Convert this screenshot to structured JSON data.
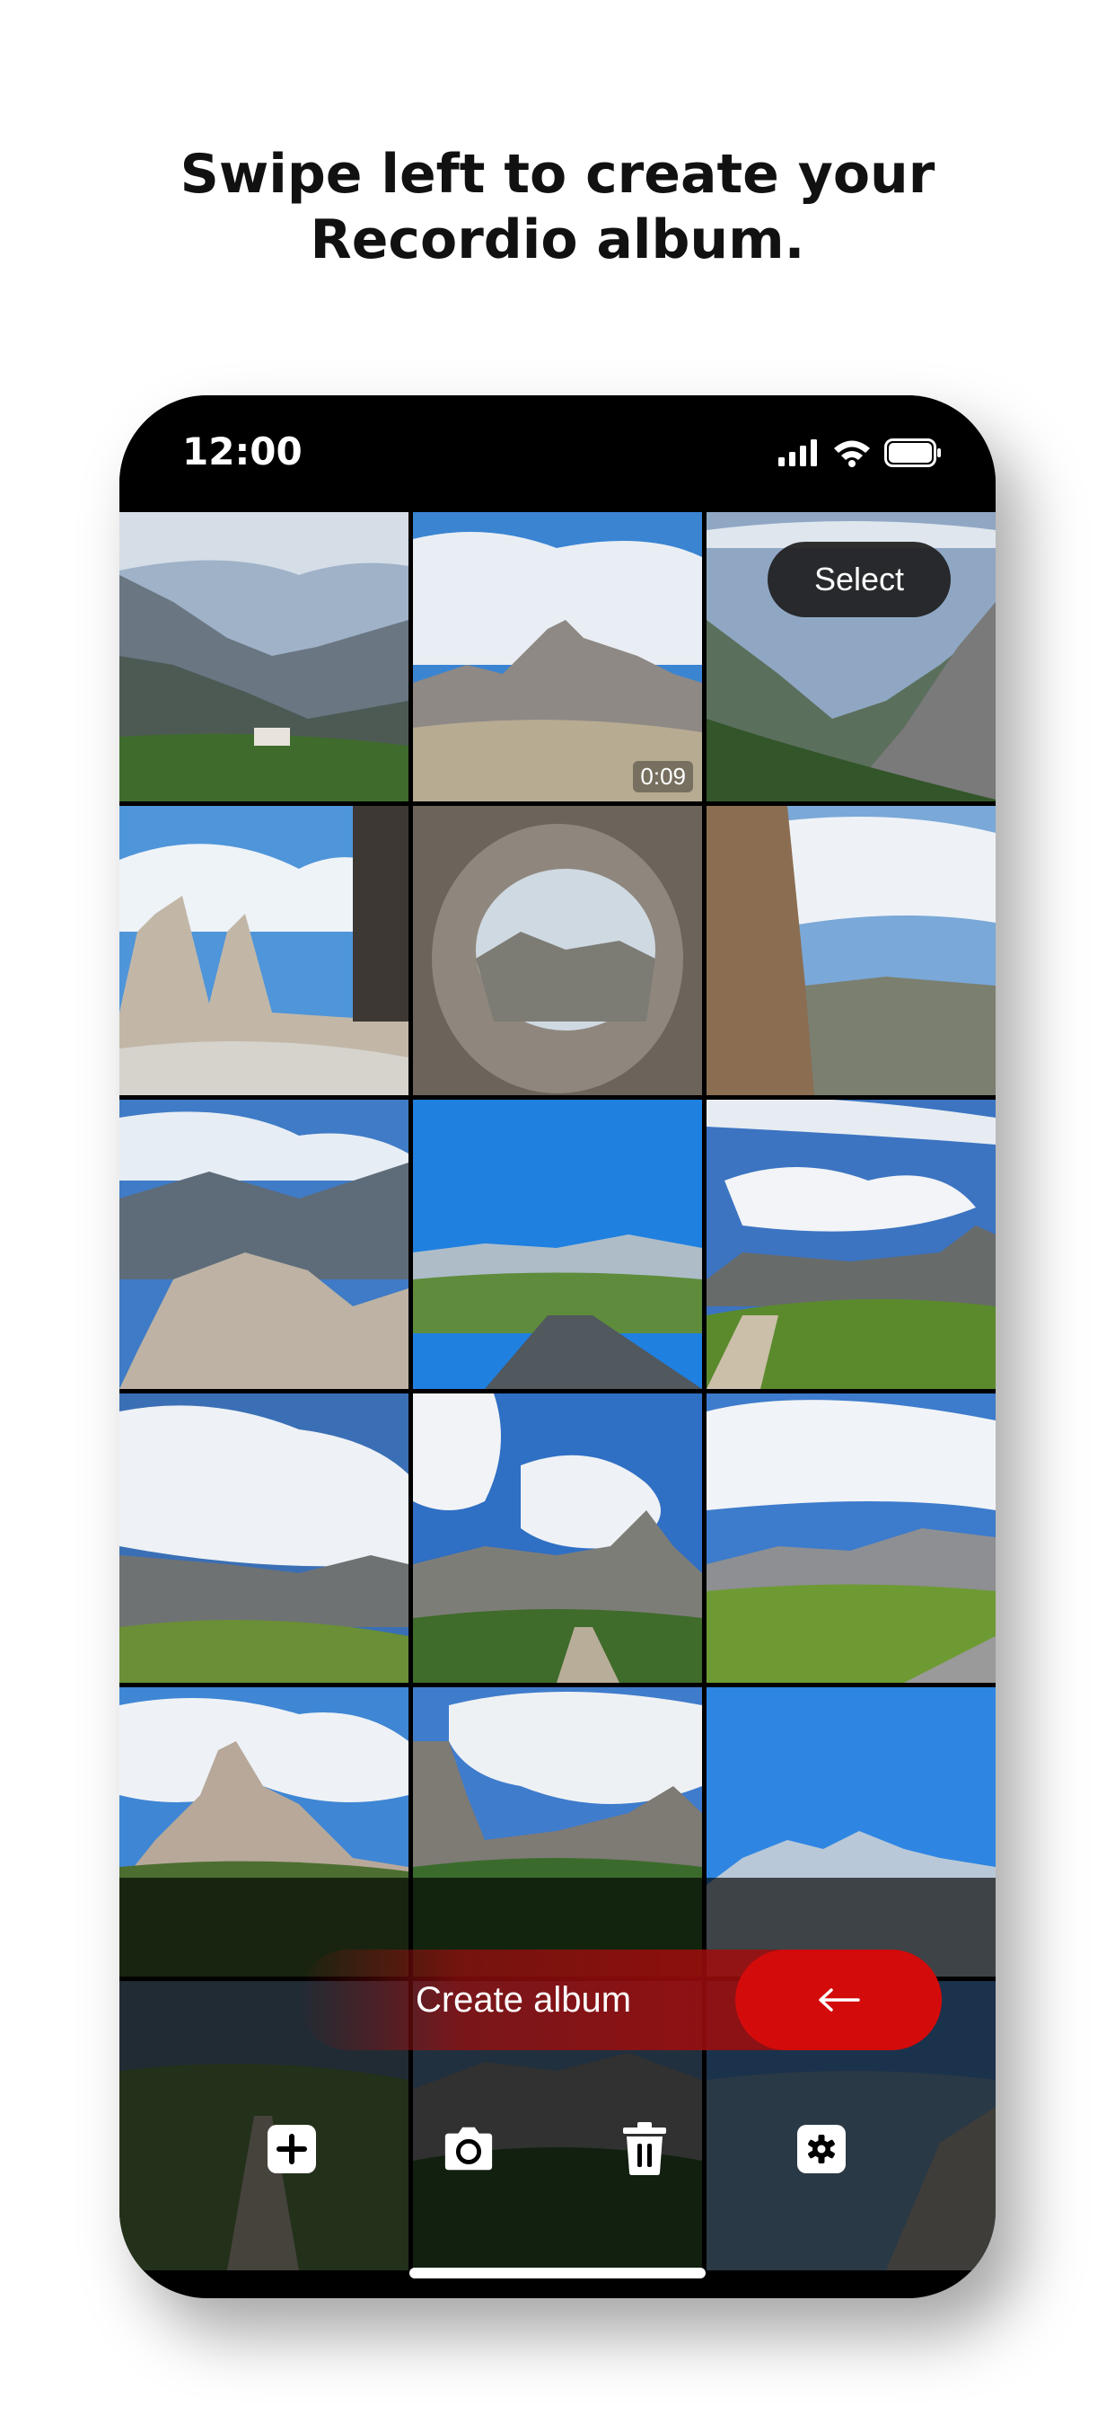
{
  "headline": {
    "line1": "Swipe left to create your",
    "line2": "Recordio album."
  },
  "status_bar": {
    "time": "12:00",
    "icons": [
      "signal-icon",
      "wifi-icon",
      "battery-icon"
    ]
  },
  "gallery": {
    "select_label": "Select",
    "video_duration": "0:09",
    "tiles": [
      "dolomites-hut-valley",
      "three-peaks-video",
      "valley-gorge",
      "three-peaks-rocky",
      "rock-hole-window",
      "cliff-overlook",
      "boulders-mountains",
      "road-meadow",
      "mountain-refuge",
      "cloud-cliffs",
      "hiking-trail",
      "fields-fence",
      "sharp-peak",
      "plateau-mountain",
      "blue-sky-range",
      "lakeside-forest",
      "evening-road",
      "mountain-lake",
      "dog-on-path",
      "pine-forest",
      "rocky-slope"
    ]
  },
  "create_album": {
    "label": "Create album",
    "arrow_icon": "arrow-left-icon"
  },
  "toolbar": {
    "items": [
      "plus-icon",
      "camera-icon",
      "trash-icon",
      "settings-icon"
    ]
  },
  "colors": {
    "accent_red": "#d40b0b",
    "background": "#ffffff",
    "phone_frame": "#000000"
  }
}
